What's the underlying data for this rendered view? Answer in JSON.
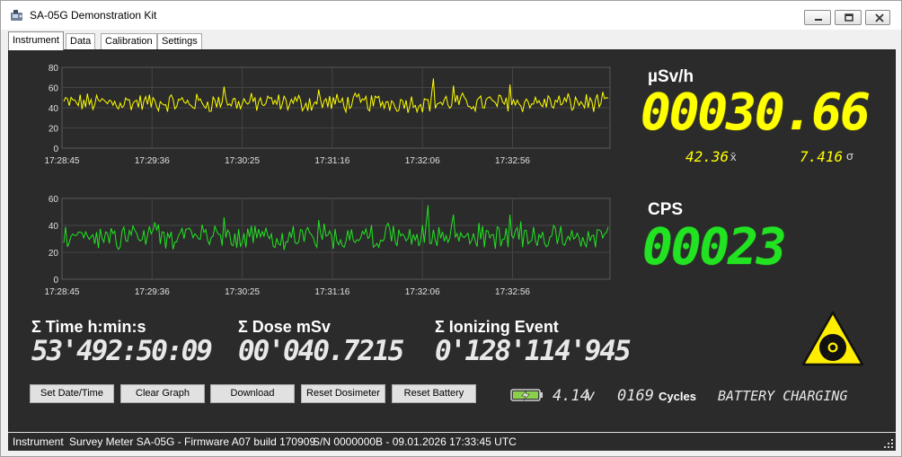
{
  "window": {
    "title": "SA-05G Demonstration Kit"
  },
  "tabs": [
    {
      "label": "Instrument",
      "active": true
    },
    {
      "label": "Data",
      "active": false
    },
    {
      "label": "Calibration",
      "active": false
    },
    {
      "label": "Settings",
      "active": false
    }
  ],
  "colors": {
    "panel_bg": "#2b2b2b",
    "dose_color": "#ffff00",
    "cps_color": "#22e322",
    "trefoil_yellow": "#ffee00"
  },
  "dose_rate": {
    "unit": "µSv/h",
    "value": "00030.66",
    "mean": "42.36",
    "mean_symbol": "x̄",
    "sigma": "7.416",
    "sigma_symbol": "σ"
  },
  "cps": {
    "label": "CPS",
    "value": "00023"
  },
  "charts": {
    "chart_data": [
      {
        "type": "line",
        "series": [
          {
            "color": "#ffff00"
          }
        ],
        "x_ticks": [
          "17:28:45",
          "17:29:36",
          "17:30:25",
          "17:31:16",
          "17:32:06",
          "17:32:56"
        ],
        "y_ticks": [
          0,
          20,
          40,
          60,
          80
        ],
        "ylim": [
          0,
          80
        ],
        "grid": true,
        "approx_level": 45
      },
      {
        "type": "line",
        "series": [
          {
            "color": "#22e322"
          }
        ],
        "x_ticks": [
          "17:28:45",
          "17:29:36",
          "17:30:25",
          "17:31:16",
          "17:32:06",
          "17:32:56"
        ],
        "y_ticks": [
          0,
          20,
          40,
          60
        ],
        "ylim": [
          0,
          60
        ],
        "grid": true,
        "approx_level": 32
      }
    ]
  },
  "summary": {
    "time_label": "Σ Time h:min:s",
    "time_value": "53'492:50:09",
    "dose_label": "Σ Dose mSv",
    "dose_value": "00'040.7215",
    "events_label": "Σ Ionizing Event",
    "events_value": "0'128'114'945"
  },
  "buttons": {
    "set_date": "Set Date/Time",
    "clear_graph": "Clear Graph",
    "download": "Download",
    "reset_dosimeter": "Reset Dosimeter",
    "reset_battery": "Reset Battery"
  },
  "battery": {
    "voltage": "4.14",
    "voltage_unit": "v",
    "cycles_value": "0169",
    "cycles_label": "Cycles",
    "status": "BATTERY CHARGING"
  },
  "statusbar": {
    "mode": "Instrument",
    "firmware": "Survey Meter SA-05G - Firmware A07 build 170909",
    "serial": "S/N 0000000B - 09.01.2026 17:33:45 UTC"
  }
}
